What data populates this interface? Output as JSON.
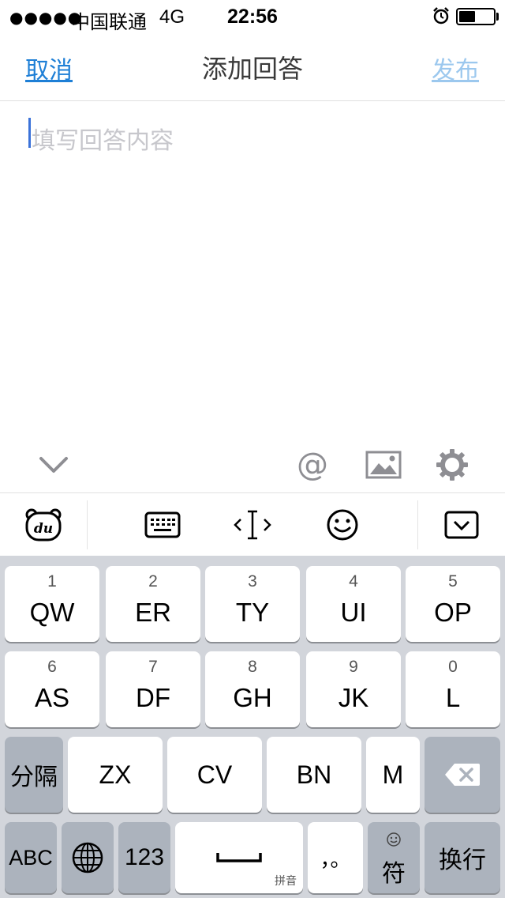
{
  "status_bar": {
    "signal": "●●●●●",
    "carrier": "中国联通",
    "network": "4G",
    "time": "22:56"
  },
  "nav": {
    "cancel_label": "取消",
    "title": "添加回答",
    "publish_label": "发布"
  },
  "editor": {
    "placeholder": "填写回答内容",
    "value": ""
  },
  "toolbar": {
    "at_label": "@"
  },
  "keyboard": {
    "row1": [
      {
        "num": "1",
        "letters": "QW"
      },
      {
        "num": "2",
        "letters": "ER"
      },
      {
        "num": "3",
        "letters": "TY"
      },
      {
        "num": "4",
        "letters": "UI"
      },
      {
        "num": "5",
        "letters": "OP"
      }
    ],
    "row2": [
      {
        "num": "6",
        "letters": "AS"
      },
      {
        "num": "7",
        "letters": "DF"
      },
      {
        "num": "8",
        "letters": "GH"
      },
      {
        "num": "9",
        "letters": "JK"
      },
      {
        "num": "0",
        "letters": "L"
      }
    ],
    "row3": {
      "separator": "分隔",
      "keys": [
        "ZX",
        "CV",
        "BN",
        "M"
      ]
    },
    "row4": {
      "abc": "ABC",
      "num": "123",
      "space_sub": "拼音",
      "punct": "，。",
      "symbol": "符",
      "return": "换行"
    }
  },
  "colors": {
    "accent": "#1e7fd6",
    "publish_disabled": "#9cc8ee",
    "caret": "#3b72d9",
    "keyboard_bg": "#d2d5db"
  }
}
